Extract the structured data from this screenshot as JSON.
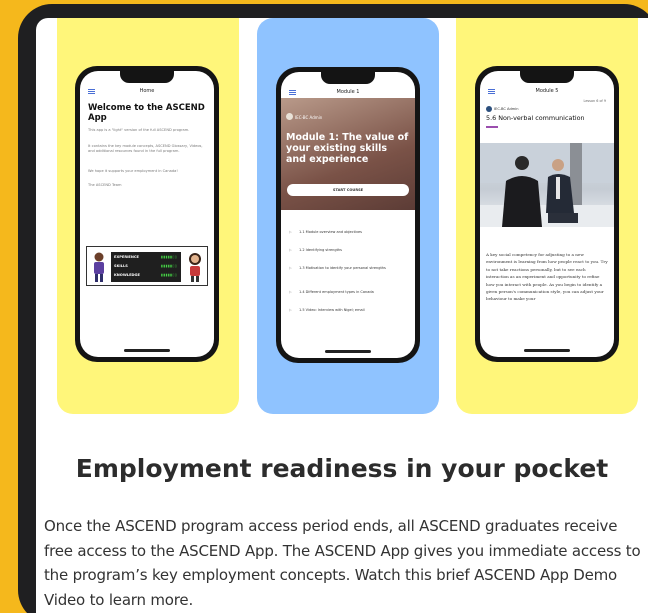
{
  "cards": [
    {
      "bg": "#fff67a",
      "app_bar": "Home",
      "title": "Welcome to the ASCEND App",
      "paragraphs": [
        "This app is a \"light\" version of the full ASCEND program.",
        "It contains the key module concepts, ASCEND Glossary, Videos, and additional resources found in the full program.",
        "We hope it supports your employment in Canada!",
        "The ASCEND Team"
      ],
      "banner_rows": [
        "EXPERIENCE",
        "SKILLS",
        "KNOWLEDGE"
      ],
      "banner_bars": "▮▮▮▮▮▯▯"
    },
    {
      "bg": "#8fc3ff",
      "app_bar": "Module 1",
      "author": "IEC-BC Admin",
      "title": "Module 1: The value of your existing skills and experience",
      "button": "START COURSE",
      "lessons": [
        "1.1 Module overview and objectives",
        "1.2 Identifying strengths",
        "1.3 Motivation to identify your personal strengths",
        "1.4 Different employment types in Canada",
        "1.5 Video: Interview with Nigel; email"
      ]
    },
    {
      "bg": "#fff67a",
      "app_bar": "Module 5",
      "lesson_counter": "Lesson 6 of 9",
      "author": "IEC-BC Admin",
      "title": "5.6 Non-verbal communication",
      "body": "A key social competency for adjusting to a new environment is learning from how people react to you. Try to not take reactions personally, but to see each interaction as an experiment and opportunity to refine how you interact with people. As you begin to identify a given person's communication style, you can adjust your behaviour to make your"
    }
  ],
  "heading": "Employment readiness in your pocket",
  "paragraph": "Once the ASCEND program access period ends, all ASCEND graduates receive free access to the ASCEND App. The ASCEND App gives you immediate access to the program’s key employment concepts. Watch this brief ASCEND App Demo Video to learn more."
}
